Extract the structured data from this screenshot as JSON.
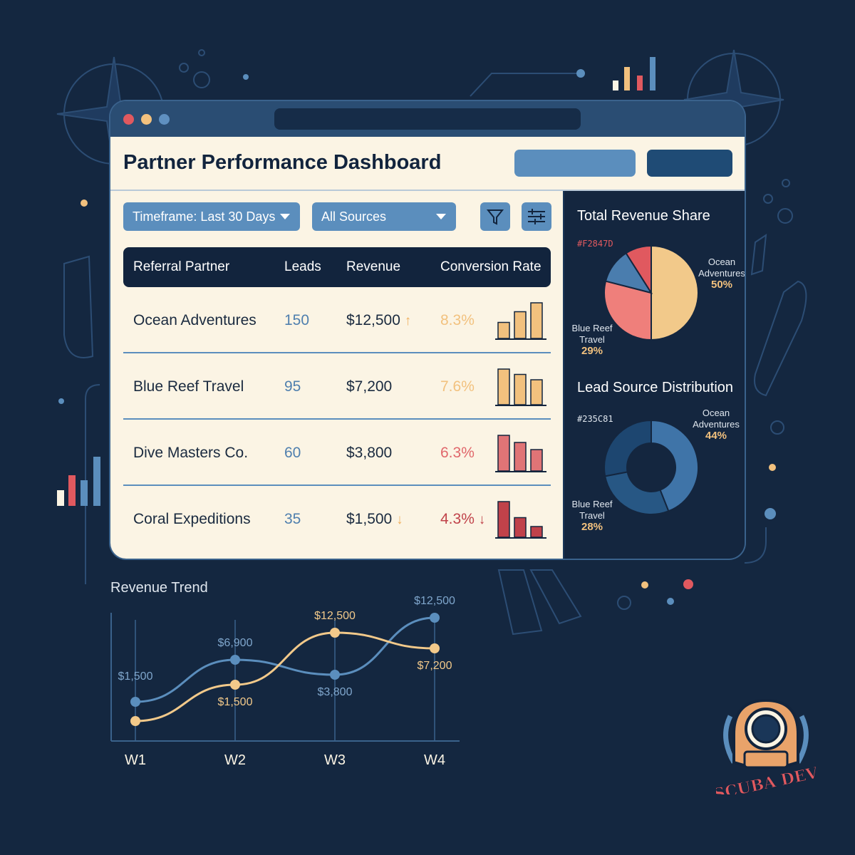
{
  "page": {
    "title": "Partner Performance Dashboard"
  },
  "filters": {
    "timeframe": "Timeframe: Last 30 Days",
    "sources": "All Sources"
  },
  "table": {
    "headers": [
      "Referral Partner",
      "Leads",
      "Revenue",
      "Conversion Rate"
    ],
    "rows": [
      {
        "partner": "Ocean Adventures",
        "leads": "150",
        "revenue": "$12,500",
        "trend": "↑",
        "rate": "8.3%",
        "rate_color": "#f2c17e",
        "bars": [
          0.45,
          0.75,
          1.0
        ],
        "bar_color": "#f2c17e"
      },
      {
        "partner": "Blue Reef Travel",
        "leads": "95",
        "revenue": "$7,200",
        "trend": "",
        "rate": "7.6%",
        "rate_color": "#f2c17e",
        "bars": [
          1.0,
          0.85,
          0.7
        ],
        "bar_color": "#f2c17e"
      },
      {
        "partner": "Dive Masters Co.",
        "leads": "60",
        "revenue": "$3,800",
        "trend": "",
        "rate": "6.3%",
        "rate_color": "#e0676b",
        "bars": [
          1.0,
          0.8,
          0.6
        ],
        "bar_color": "#e07476"
      },
      {
        "partner": "Coral Expeditions",
        "leads": "35",
        "revenue": "$1,500",
        "trend": "↓",
        "rate": "4.3%",
        "rate_color": "#c0424a",
        "bars": [
          1.0,
          0.55,
          0.3
        ],
        "bar_color": "#c0424a"
      }
    ]
  },
  "revenue_share": {
    "title": "Total Revenue Share",
    "hex_label": "#F2847D",
    "label_ocean_name": "Ocean Adventures",
    "label_ocean_pct": "50%",
    "label_blue_name": "Blue Reef Travel",
    "label_blue_pct": "29%",
    "slices": [
      {
        "value": 50,
        "color": "#f2c98a"
      },
      {
        "value": 29,
        "color": "#ef7f7b"
      },
      {
        "value": 12,
        "color": "#4a7dae"
      },
      {
        "value": 9,
        "color": "#e0595f"
      }
    ]
  },
  "lead_distribution": {
    "title": "Lead Source Distribution",
    "hex_label": "#235C81",
    "label_ocean_name": "Ocean Adventures",
    "label_ocean_pct": "44%",
    "label_blue_name": "Blue Reef Travel",
    "label_blue_pct": "28%",
    "slices": [
      {
        "value": 44,
        "color": "#3f74a8"
      },
      {
        "value": 28,
        "color": "#275784"
      },
      {
        "value": 28,
        "color": "#1d4670"
      }
    ]
  },
  "trend": {
    "title": "Revenue Trend",
    "weeks": [
      "W1",
      "W2",
      "W3",
      "W4"
    ],
    "blue_series": [
      1500,
      6900,
      3800,
      12500
    ],
    "blue_labels": [
      "$1,500",
      "$6,900",
      "$3,800",
      "$12,500"
    ],
    "gold_series": [
      200,
      1500,
      12500,
      7200
    ],
    "gold_labels": [
      "",
      "$1,500",
      "$12,500",
      "$7,200"
    ],
    "blue_color": "#5b8ebd",
    "gold_color": "#f2c98a"
  },
  "logo": {
    "text": "SCUBA DEV"
  },
  "colors": {
    "background": "#142740",
    "accent_blue": "#5b8ebd",
    "accent_gold": "#f2c17e",
    "accent_red": "#e0595f"
  }
}
